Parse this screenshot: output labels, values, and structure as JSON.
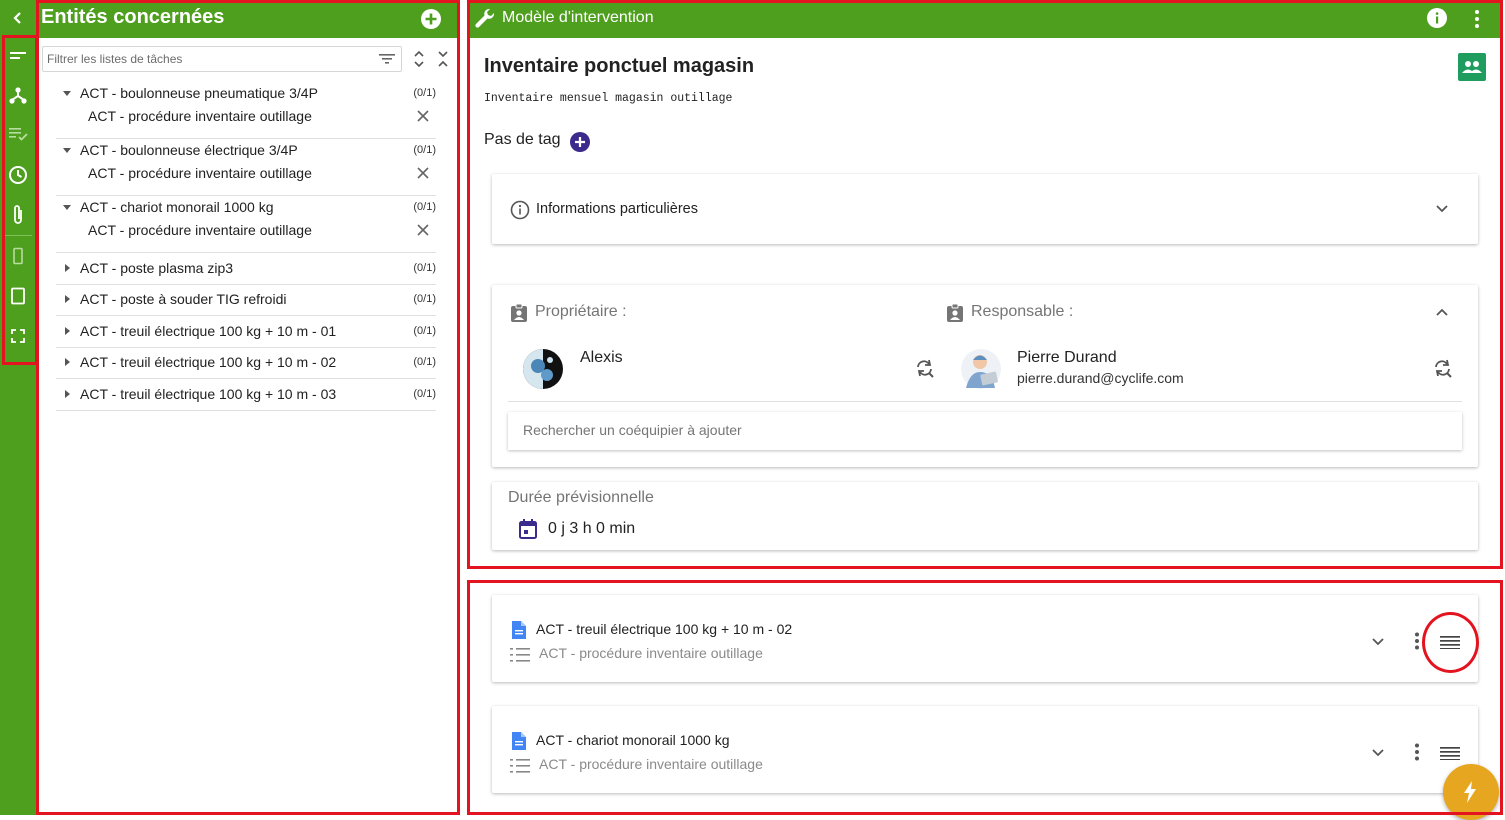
{
  "left_panel": {
    "title": "Entités concernées",
    "filter_placeholder": "Filtrer les listes de tâches",
    "groups": [
      {
        "label": "ACT - boulonneuse pneumatique 3/4P",
        "count": "(0/1)",
        "expanded": true,
        "child": "ACT - procédure inventaire outillage"
      },
      {
        "label": "ACT - boulonneuse électrique 3/4P",
        "count": "(0/1)",
        "expanded": true,
        "child": "ACT - procédure inventaire outillage"
      },
      {
        "label": "ACT - chariot monorail 1000 kg",
        "count": "(0/1)",
        "expanded": true,
        "child": "ACT - procédure inventaire outillage"
      },
      {
        "label": "ACT - poste plasma zip3",
        "count": "(0/1)",
        "expanded": false
      },
      {
        "label": "ACT - poste à souder TIG refroidi",
        "count": "(0/1)",
        "expanded": false
      },
      {
        "label": "ACT - treuil électrique 100 kg + 10 m - 01",
        "count": "(0/1)",
        "expanded": false
      },
      {
        "label": "ACT - treuil électrique 100 kg + 10 m - 02",
        "count": "(0/1)",
        "expanded": false
      },
      {
        "label": "ACT - treuil électrique 100 kg + 10 m - 03",
        "count": "(0/1)",
        "expanded": false
      }
    ]
  },
  "rail_icons": [
    "menu-lines-icon",
    "hierarchy-icon",
    "checklist-icon",
    "clock-icon",
    "paperclip-icon",
    "phone-icon",
    "tablet-icon",
    "fullscreen-icon"
  ],
  "model": {
    "header_title": "Modèle d'intervention",
    "name": "Inventaire ponctuel magasin",
    "description": "Inventaire mensuel magasin outillage",
    "tags_label": "Pas de tag",
    "info_label": "Informations particulières",
    "owner_label": "Propriétaire :",
    "owner_name": "Alexis",
    "responsible_label": "Responsable :",
    "responsible_name": "Pierre Durand",
    "responsible_email": "pierre.durand@cyclife.com",
    "teammate_placeholder": "Rechercher un coéquipier à ajouter",
    "duration_label": "Durée prévisionnelle",
    "duration_value": "0 j 3 h 0 min"
  },
  "tasks": [
    {
      "title": "ACT - treuil électrique 100 kg + 10 m - 02",
      "subtitle": "ACT - procédure inventaire outillage"
    },
    {
      "title": "ACT - chariot monorail 1000 kg",
      "subtitle": "ACT - procédure inventaire outillage"
    }
  ],
  "colors": {
    "header_green": "#4f9f1f",
    "annotation_red": "#e3131f",
    "fab_gold": "#e6a61f",
    "tag_purple": "#3c2a8c"
  }
}
